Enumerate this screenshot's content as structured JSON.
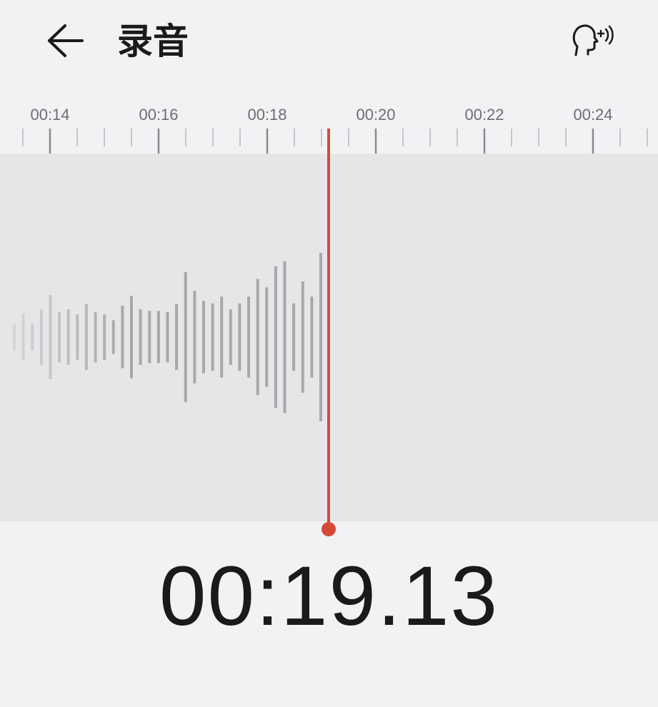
{
  "header": {
    "title": "录音",
    "back_icon": "arrow-left-icon",
    "voice_icon": "voice-enhance-icon"
  },
  "ruler": {
    "labels": [
      "00:14",
      "00:16",
      "00:18",
      "00:20",
      "00:22",
      "00:24"
    ]
  },
  "waveform": {
    "levels": [
      0.16,
      0.28,
      0.16,
      0.33,
      0.5,
      0.3,
      0.33,
      0.27,
      0.39,
      0.3,
      0.27,
      0.2,
      0.37,
      0.49,
      0.33,
      0.31,
      0.31,
      0.3,
      0.39,
      0.77,
      0.55,
      0.43,
      0.4,
      0.48,
      0.33,
      0.4,
      0.48,
      0.69,
      0.59,
      0.84,
      0.9,
      0.4,
      0.66,
      0.48,
      1.0
    ]
  },
  "colors": {
    "playhead": "#d44a3a",
    "wave": "#a8a8aa",
    "background": "#f2f2f4",
    "wave_background": "#e6e6e9"
  },
  "timer": {
    "value": "00:19.13"
  }
}
